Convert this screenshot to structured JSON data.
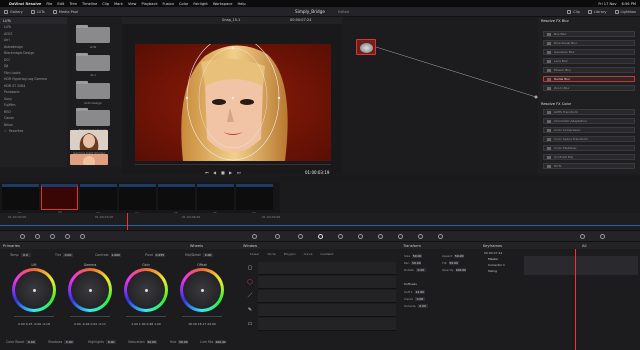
{
  "menubar": {
    "app": "DaVinci Resolve",
    "items": [
      "File",
      "Edit",
      "Trim",
      "Timeline",
      "Clip",
      "Mark",
      "View",
      "Playback",
      "Fusion",
      "Color",
      "Fairlight",
      "Workspace",
      "Help"
    ],
    "right": [
      "Fri 17 Nov",
      "6:56 PM"
    ]
  },
  "toolbar": {
    "left": [
      "Gallery",
      "LUTs",
      "Media Pool"
    ],
    "project": "Simply_Bridge",
    "edited": "Edited",
    "right": [
      "Clip",
      "Library",
      "Lightbox"
    ]
  },
  "luts": {
    "header": "LUTs",
    "items": [
      "LUTs",
      "ACES",
      "Arri",
      "Astrodesign",
      "Blackmagic Design",
      "DCI",
      "DJI",
      "Film Looks",
      "HDR Hyperlog Log Gamma",
      "HDR ST 2084",
      "Panasonic",
      "Sony",
      "Fujifilm",
      "RED",
      "Canon",
      "Nikon"
    ],
    "favorites": "Favorites"
  },
  "thumbs": {
    "folders": [
      "LUTs",
      "Arri",
      "Astrodesign",
      "Blackmagic Design"
    ],
    "images": [
      "Gamma Light Shader",
      "Orange Light Shader"
    ]
  },
  "viewer": {
    "clip_name": "Snap_15.1",
    "timecode_top": "00:00:07:24",
    "timecode": "01:00:03:19"
  },
  "library": {
    "header1": "Resolve FX Blur",
    "blur_items": [
      "Box Blur",
      "Directional Blur",
      "Gaussian Blur",
      "Lens Blur",
      "Mosaic Blur",
      "Radial Blur",
      "Zoom Blur"
    ],
    "selected_index": 5,
    "header2": "Resolve FX Color",
    "color_items": [
      "ACES Transform",
      "Chromatic Adaptation",
      "Color Compressor",
      "Color Space Transform",
      "Color Stabilizer",
      "Contrast Pop",
      "DCTL"
    ]
  },
  "clips": {
    "items": [
      "01",
      "02",
      "03",
      "04",
      "05",
      "06",
      "07"
    ],
    "selected_index": 1
  },
  "ruler": {
    "ticks": [
      "01:00:00:00",
      "01:00:03:00",
      "01:00:06:00",
      "01:00:09:00"
    ]
  },
  "primaries": {
    "title": "Primaries",
    "wheels_label": "Wheels",
    "top_params": [
      {
        "label": "Temp",
        "value": "0.0"
      },
      {
        "label": "Tint",
        "value": "0.00"
      },
      {
        "label": "Contrast",
        "value": "1.000"
      },
      {
        "label": "Pivot",
        "value": "0.435"
      },
      {
        "label": "Mid/Detail",
        "value": "0.00"
      }
    ],
    "wheels": [
      {
        "name": "Lift",
        "vals": "0.00  0.23  -0.06  -0.18"
      },
      {
        "name": "Gamma",
        "vals": "0.00  -0.04  0.02  -0.11"
      },
      {
        "name": "Gain",
        "vals": "1.00  1.00  0.98  1.00"
      },
      {
        "name": "Offset",
        "vals": "16.36  16.17  24.00"
      }
    ],
    "bottom_params": [
      {
        "label": "Color Boost",
        "value": "0.00"
      },
      {
        "label": "Shadows",
        "value": "0.00"
      },
      {
        "label": "Highlights",
        "value": "0.00"
      },
      {
        "label": "Saturation",
        "value": "50.00"
      },
      {
        "label": "Hue",
        "value": "50.00"
      },
      {
        "label": "Lum Mix",
        "value": "100.00"
      }
    ]
  },
  "window": {
    "title": "Window",
    "tabs": [
      "Linear",
      "Circle",
      "Polygon",
      "Curve",
      "Gradient"
    ],
    "rows": [
      "",
      "",
      "",
      "",
      ""
    ]
  },
  "transform": {
    "title": "Transform",
    "fields": [
      {
        "label": "Size",
        "value": "50.00"
      },
      {
        "label": "Aspect",
        "value": "50.00"
      },
      {
        "label": "Pan",
        "value": "50.00"
      },
      {
        "label": "Tilt",
        "value": "50.00"
      },
      {
        "label": "Rotate",
        "value": "0.00"
      },
      {
        "label": "Opacity",
        "value": "100.00"
      }
    ],
    "softness_title": "Softness",
    "softness": [
      {
        "label": "Soft 1",
        "value": "12.00"
      },
      {
        "label": "Inside",
        "value": "0.00"
      },
      {
        "label": "Outside",
        "value": "0.00"
      }
    ]
  },
  "keyframes": {
    "title": "Keyframes",
    "mode": "All",
    "timecode": "00:00:07:24",
    "rows": [
      "Master",
      "Corrector 1",
      "Sizing"
    ]
  }
}
